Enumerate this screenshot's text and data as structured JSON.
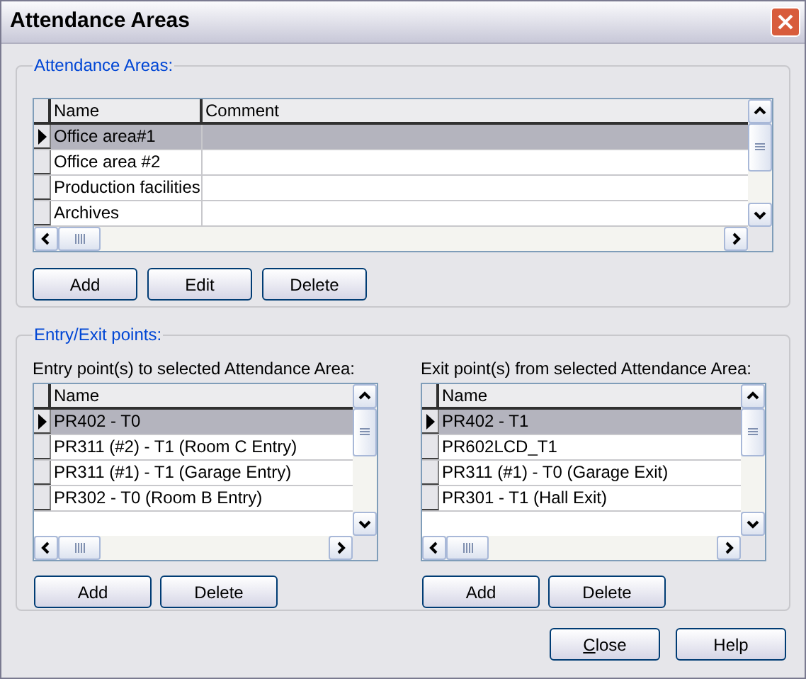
{
  "window": {
    "title": "Attendance Areas"
  },
  "areas_group": {
    "legend": "Attendance Areas:",
    "table": {
      "columns": [
        "Name",
        "Comment"
      ],
      "rows": [
        {
          "name": "Office area#1",
          "selected": true
        },
        {
          "name": "Office area #2",
          "selected": false
        },
        {
          "name": "Production facilities",
          "selected": false
        },
        {
          "name": "Archives",
          "selected": false
        }
      ]
    },
    "buttons": [
      "Add",
      "Edit",
      "Delete"
    ]
  },
  "points_group": {
    "legend": "Entry/Exit points:",
    "panels": [
      {
        "label": "Entry point(s) to selected Attendance Area:",
        "columns": [
          "Name"
        ],
        "rows": [
          {
            "name": "PR402 - T0",
            "selected": true
          },
          {
            "name": "PR311 (#2) - T1 (Room C Entry)",
            "selected": false
          },
          {
            "name": "PR311 (#1) - T1 (Garage Entry)",
            "selected": false
          },
          {
            "name": "PR302 - T0 (Room B Entry)",
            "selected": false
          }
        ],
        "buttons": [
          "Add",
          "Delete"
        ]
      },
      {
        "label": "Exit point(s) from selected Attendance Area:",
        "columns": [
          "Name"
        ],
        "rows": [
          {
            "name": "PR402 - T1",
            "selected": true
          },
          {
            "name": "PR602LCD_T1",
            "selected": false
          },
          {
            "name": "PR311 (#1) - T0 (Garage Exit)",
            "selected": false
          },
          {
            "name": "PR301 - T1 (Hall Exit)",
            "selected": false
          }
        ],
        "buttons": [
          "Add",
          "Delete"
        ]
      }
    ]
  },
  "footer_buttons": [
    "Close",
    "Help"
  ]
}
